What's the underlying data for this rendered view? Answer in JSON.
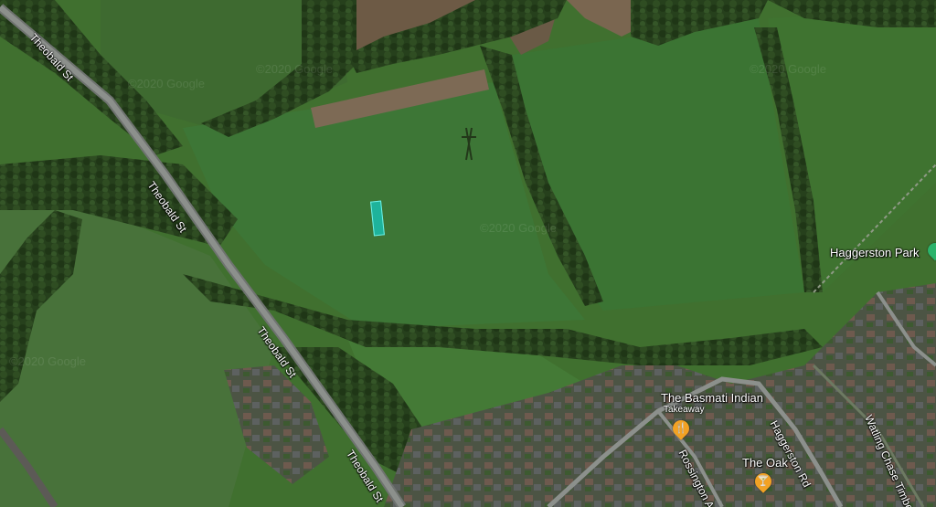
{
  "map": {
    "roads": {
      "theobald_1": "Theobald St",
      "theobald_2": "Theobald St",
      "theobald_3": "Theobald St",
      "theobald_4": "Theobald St",
      "rossington": "Rossington Ave",
      "haggerston_rd": "Haggerston Rd",
      "watling_chase": "Watling Chase Timbe..."
    },
    "places": {
      "park": {
        "name": "Haggerston Park",
        "icon": "park-pin-icon"
      },
      "basmati": {
        "name": "The Basmati Indian",
        "sub": "Takeaway",
        "icon": "restaurant-pin-icon"
      },
      "oak": {
        "name": "The Oak",
        "icon": "bar-pin-icon"
      }
    },
    "watermarks": [
      "©2020 Google",
      "©2020 Google",
      "©2020 Google",
      "©2020 Google",
      "©2020 Google"
    ],
    "colors": {
      "field": "#3f6a2f",
      "poi_pin": "#f2a224",
      "park_pin": "#2bb36b",
      "marker": "#14c8be"
    }
  }
}
